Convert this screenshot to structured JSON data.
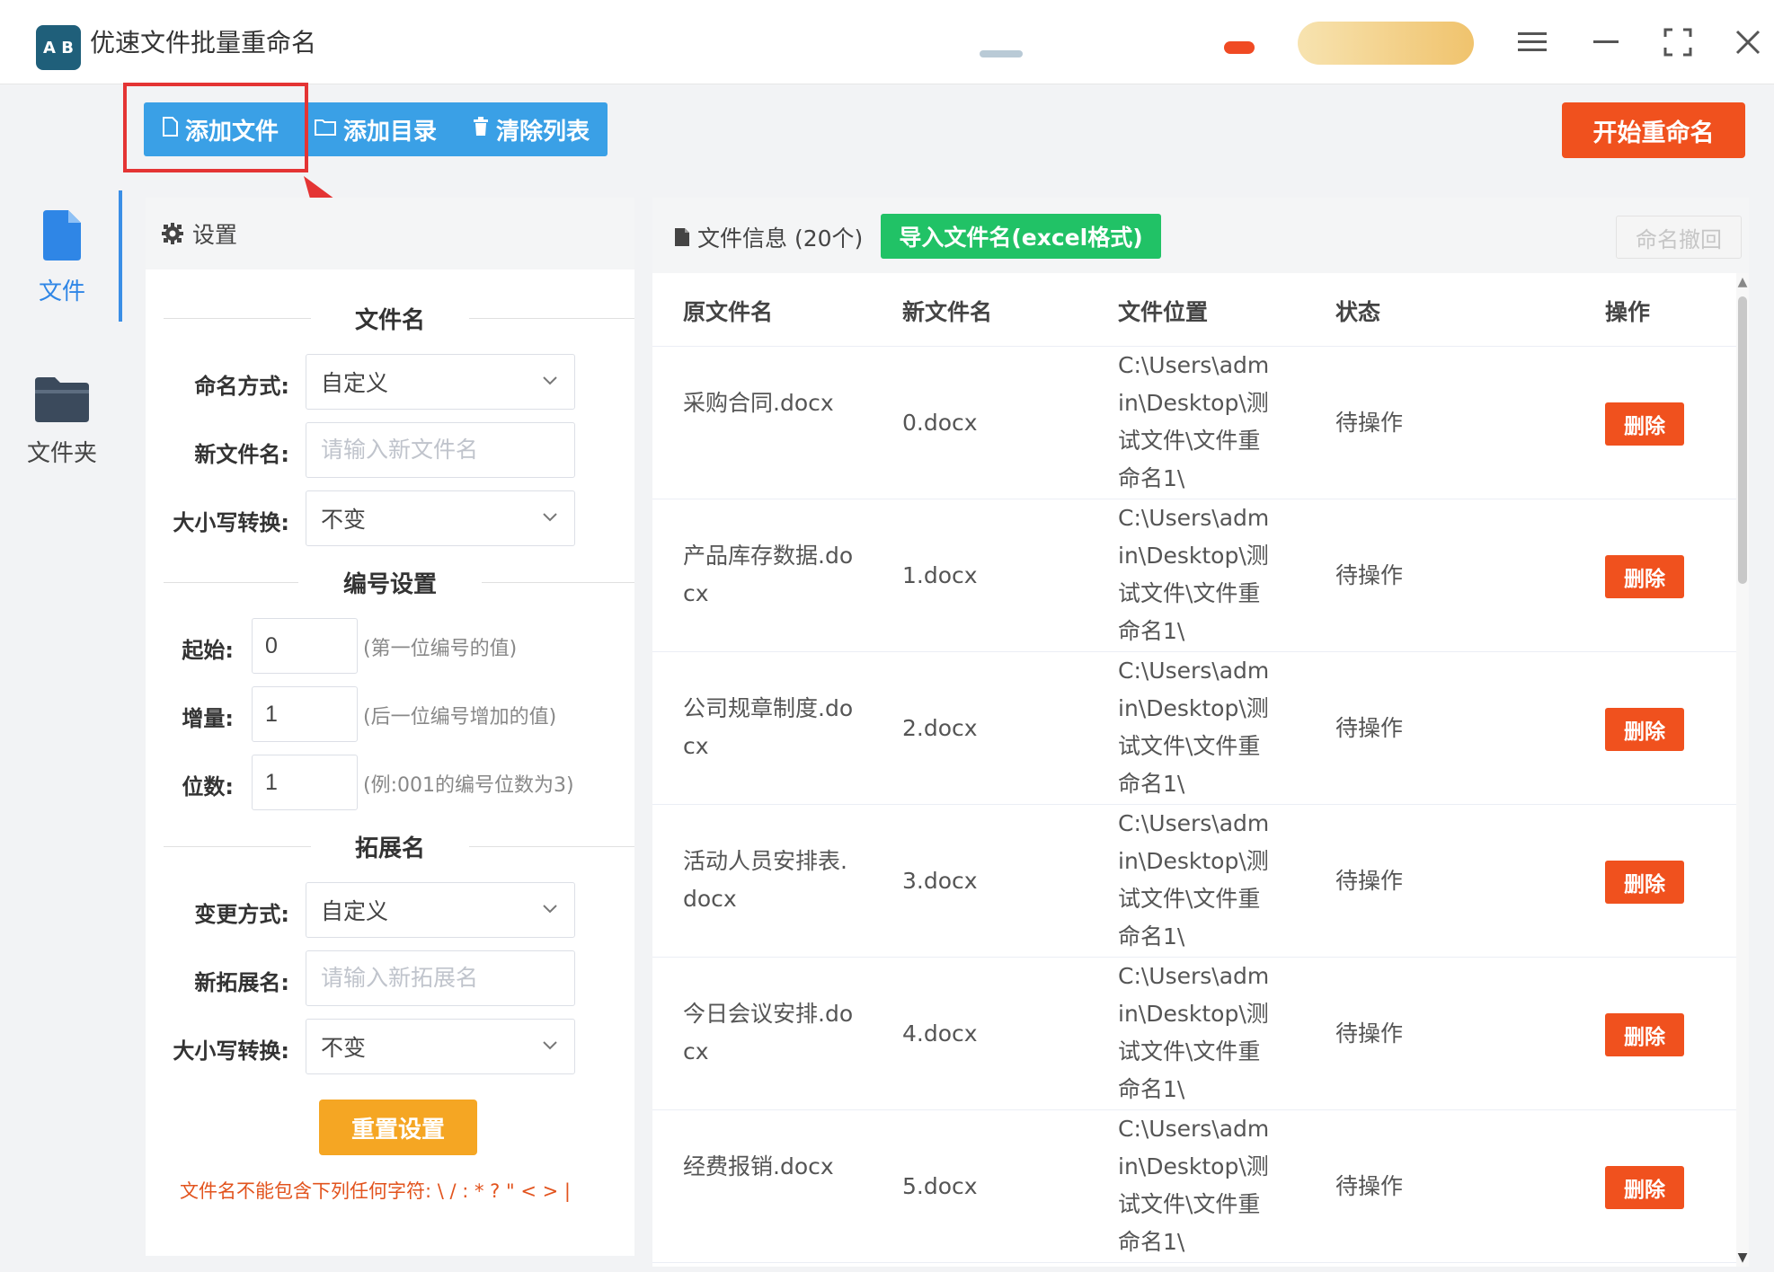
{
  "window": {
    "logo_text": "A B",
    "title": "优速文件批量重命名",
    "menu_icon": "menu-icon",
    "minimize_icon": "minimize-icon",
    "maximize_icon": "maximize-icon",
    "close_icon": "close-icon"
  },
  "toolbar": {
    "add_file": "添加文件",
    "add_folder": "添加目录",
    "clear_list": "清除列表",
    "start": "开始重命名"
  },
  "rail": {
    "file_label": "文件",
    "folder_label": "文件夹"
  },
  "settings": {
    "header": "设置",
    "filename_section": "文件名",
    "naming_mode_label": "命名方式:",
    "naming_mode_value": "自定义",
    "new_name_label": "新文件名:",
    "new_name_placeholder": "请输入新文件名",
    "case_label": "大小写转换:",
    "case_value": "不变",
    "numbering_section": "编号设置",
    "start_label": "起始:",
    "start_value": "0",
    "start_hint": "(第一位编号的值)",
    "step_label": "增量:",
    "step_value": "1",
    "step_hint": "(后一位编号增加的值)",
    "digits_label": "位数:",
    "digits_value": "1",
    "digits_hint": "(例:001的编号位数为3)",
    "ext_section": "拓展名",
    "ext_mode_label": "变更方式:",
    "ext_mode_value": "自定义",
    "new_ext_label": "新拓展名:",
    "new_ext_placeholder": "请输入新拓展名",
    "ext_case_label": "大小写转换:",
    "ext_case_value": "不变",
    "reset": "重置设置",
    "warning": "文件名不能包含下列任何字符: \\ / : * ? \" < > |"
  },
  "files": {
    "title": "文件信息 (20个)",
    "import_button": "导入文件名(excel格式)",
    "undo_button": "命名撤回",
    "columns": [
      "原文件名",
      "新文件名",
      "文件位置",
      "状态",
      "操作"
    ],
    "rows": [
      {
        "orig": "采购合同.docx",
        "new": "0.docx",
        "path": "C:\\Users\\admin\\Desktop\\测试文件\\文件重命名1\\",
        "status": "待操作",
        "action": "删除"
      },
      {
        "orig": "产品库存数据.docx",
        "new": "1.docx",
        "path": "C:\\Users\\admin\\Desktop\\测试文件\\文件重命名1\\",
        "status": "待操作",
        "action": "删除"
      },
      {
        "orig": "公司规章制度.docx",
        "new": "2.docx",
        "path": "C:\\Users\\admin\\Desktop\\测试文件\\文件重命名1\\",
        "status": "待操作",
        "action": "删除"
      },
      {
        "orig": "活动人员安排表.docx",
        "new": "3.docx",
        "path": "C:\\Users\\admin\\Desktop\\测试文件\\文件重命名1\\",
        "status": "待操作",
        "action": "删除"
      },
      {
        "orig": "今日会议安排.docx",
        "new": "4.docx",
        "path": "C:\\Users\\admin\\Desktop\\测试文件\\文件重命名1\\",
        "status": "待操作",
        "action": "删除"
      },
      {
        "orig": "经费报销.docx",
        "new": "5.docx",
        "path": "C:\\Users\\admin\\Desktop\\测试文件\\文件重命名1\\",
        "status": "待操作",
        "action": "删除"
      }
    ]
  },
  "colors": {
    "toolbar_blue": "#3aa0e6",
    "start_red": "#f0511e",
    "import_green": "#21c266",
    "reset_orange": "#f5a623",
    "highlight_red": "#e43434"
  }
}
